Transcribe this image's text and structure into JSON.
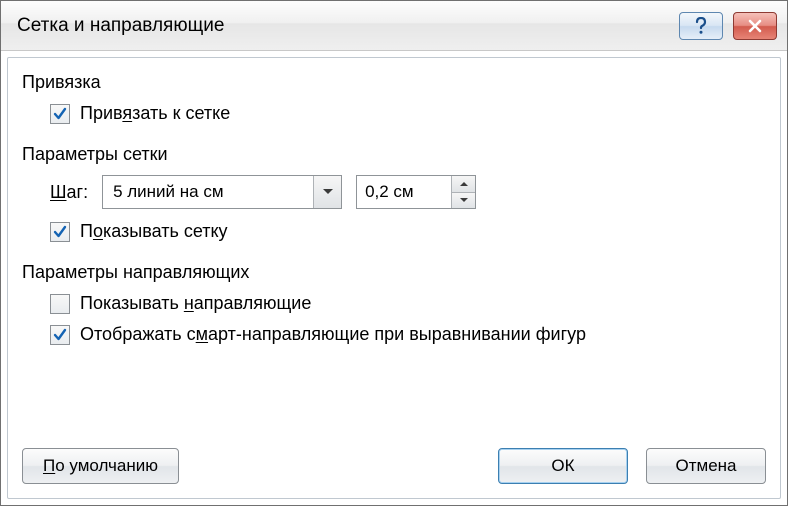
{
  "title": "Сетка и направляющие",
  "groups": {
    "snap": {
      "label": "Привязка",
      "snap_to_grid": {
        "label_pre": "Прив",
        "label_u": "я",
        "label_post": "зать к сетке",
        "checked": true
      }
    },
    "grid": {
      "label": "Параметры сетки",
      "step_label_u": "Ш",
      "step_label_post": "аг:",
      "step_value": "5 линий на см",
      "spacing_value": "0,2 см",
      "show_grid": {
        "label_pre": "П",
        "label_u": "о",
        "label_post": "казывать сетку",
        "checked": true
      }
    },
    "guides": {
      "label": "Параметры направляющих",
      "show_guides": {
        "label_pre": "Показывать ",
        "label_u": "н",
        "label_post": "аправляющие",
        "checked": false
      },
      "smart_guides": {
        "label_pre": "Отображать с",
        "label_u": "м",
        "label_post": "арт-направляющие при выравнивании фигур",
        "checked": true
      }
    }
  },
  "buttons": {
    "default_u": "П",
    "default_post": "о умолчанию",
    "ok": "ОК",
    "cancel": "Отмена"
  }
}
